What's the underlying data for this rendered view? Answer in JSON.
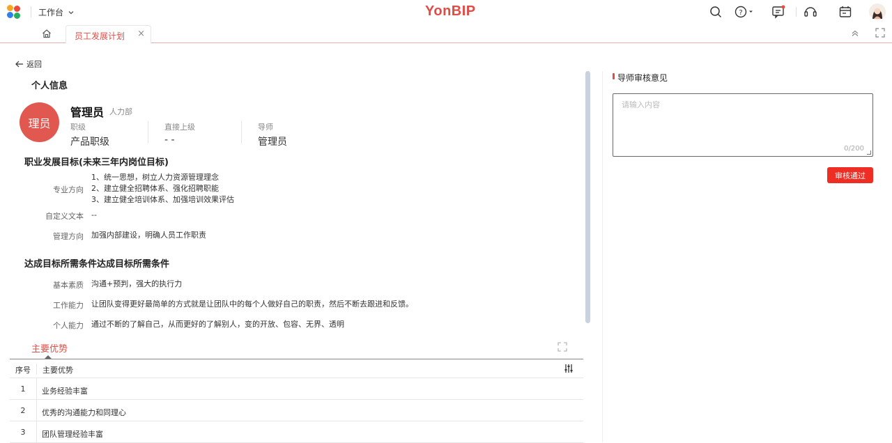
{
  "topbar": {
    "workbench_label": "工作台",
    "brand": "YonBIP",
    "logo_colors": [
      "#f5a623",
      "#e94b3c",
      "#2f80ed",
      "#27ae60"
    ],
    "icons": [
      "search-icon",
      "help-icon",
      "message-icon",
      "headset-icon",
      "calendar-icon",
      "user-avatar"
    ]
  },
  "tabs": {
    "home_icon": "home-icon",
    "active_tab_label": "员工发展计划",
    "close_label": "×"
  },
  "back_label": "返回",
  "personal": {
    "section_title": "个人信息",
    "avatar_text": "理员",
    "name": "管理员",
    "dept": "人力部",
    "rank_label": "职级",
    "rank_value": "产品职级",
    "superior_label": "直接上级",
    "superior_value": "- -",
    "mentor_label": "导师",
    "mentor_value": "管理员"
  },
  "career": {
    "section_title": "职业发展目标(未来三年内岗位目标)",
    "professional_label": "专业方向",
    "professional_lines": [
      "1、统一思想，树立人力资源管理理念",
      "2、建立健全招聘体系、强化招聘职能",
      "3、建立健全培训体系、加强培训效果评估"
    ],
    "custom_label": "自定义文本",
    "custom_value": "--",
    "management_label": "管理方向",
    "management_value": "加强内部建设，明确人员工作职责"
  },
  "conditions": {
    "section_title": "达成目标所需条件达成目标所需条件",
    "basic_label": "基本素质",
    "basic_value": "沟通+预判，强大的执行力",
    "work_label": "工作能力",
    "work_value": "让团队变得更好最简单的方式就是让团队中的每个人做好自己的职责，然后不断去跟进和反馈。",
    "personal_label": "个人能力",
    "personal_value": "通过不断的了解自己，从而更好的了解别人，变的开放、包容、无界、透明"
  },
  "advantages": {
    "tab_label": "主要优势",
    "col_index": "序号",
    "col_name": "主要优势",
    "rows": [
      {
        "index": "1",
        "name": "业务经验丰富"
      },
      {
        "index": "2",
        "name": "优秀的沟通能力和同理心"
      },
      {
        "index": "3",
        "name": "团队管理经验丰富"
      }
    ]
  },
  "review": {
    "title": "导师审核意见",
    "placeholder": "请输入内容",
    "counter": "0/200",
    "approve_label": "审核通过",
    "accent_color": "#ee2e24"
  }
}
